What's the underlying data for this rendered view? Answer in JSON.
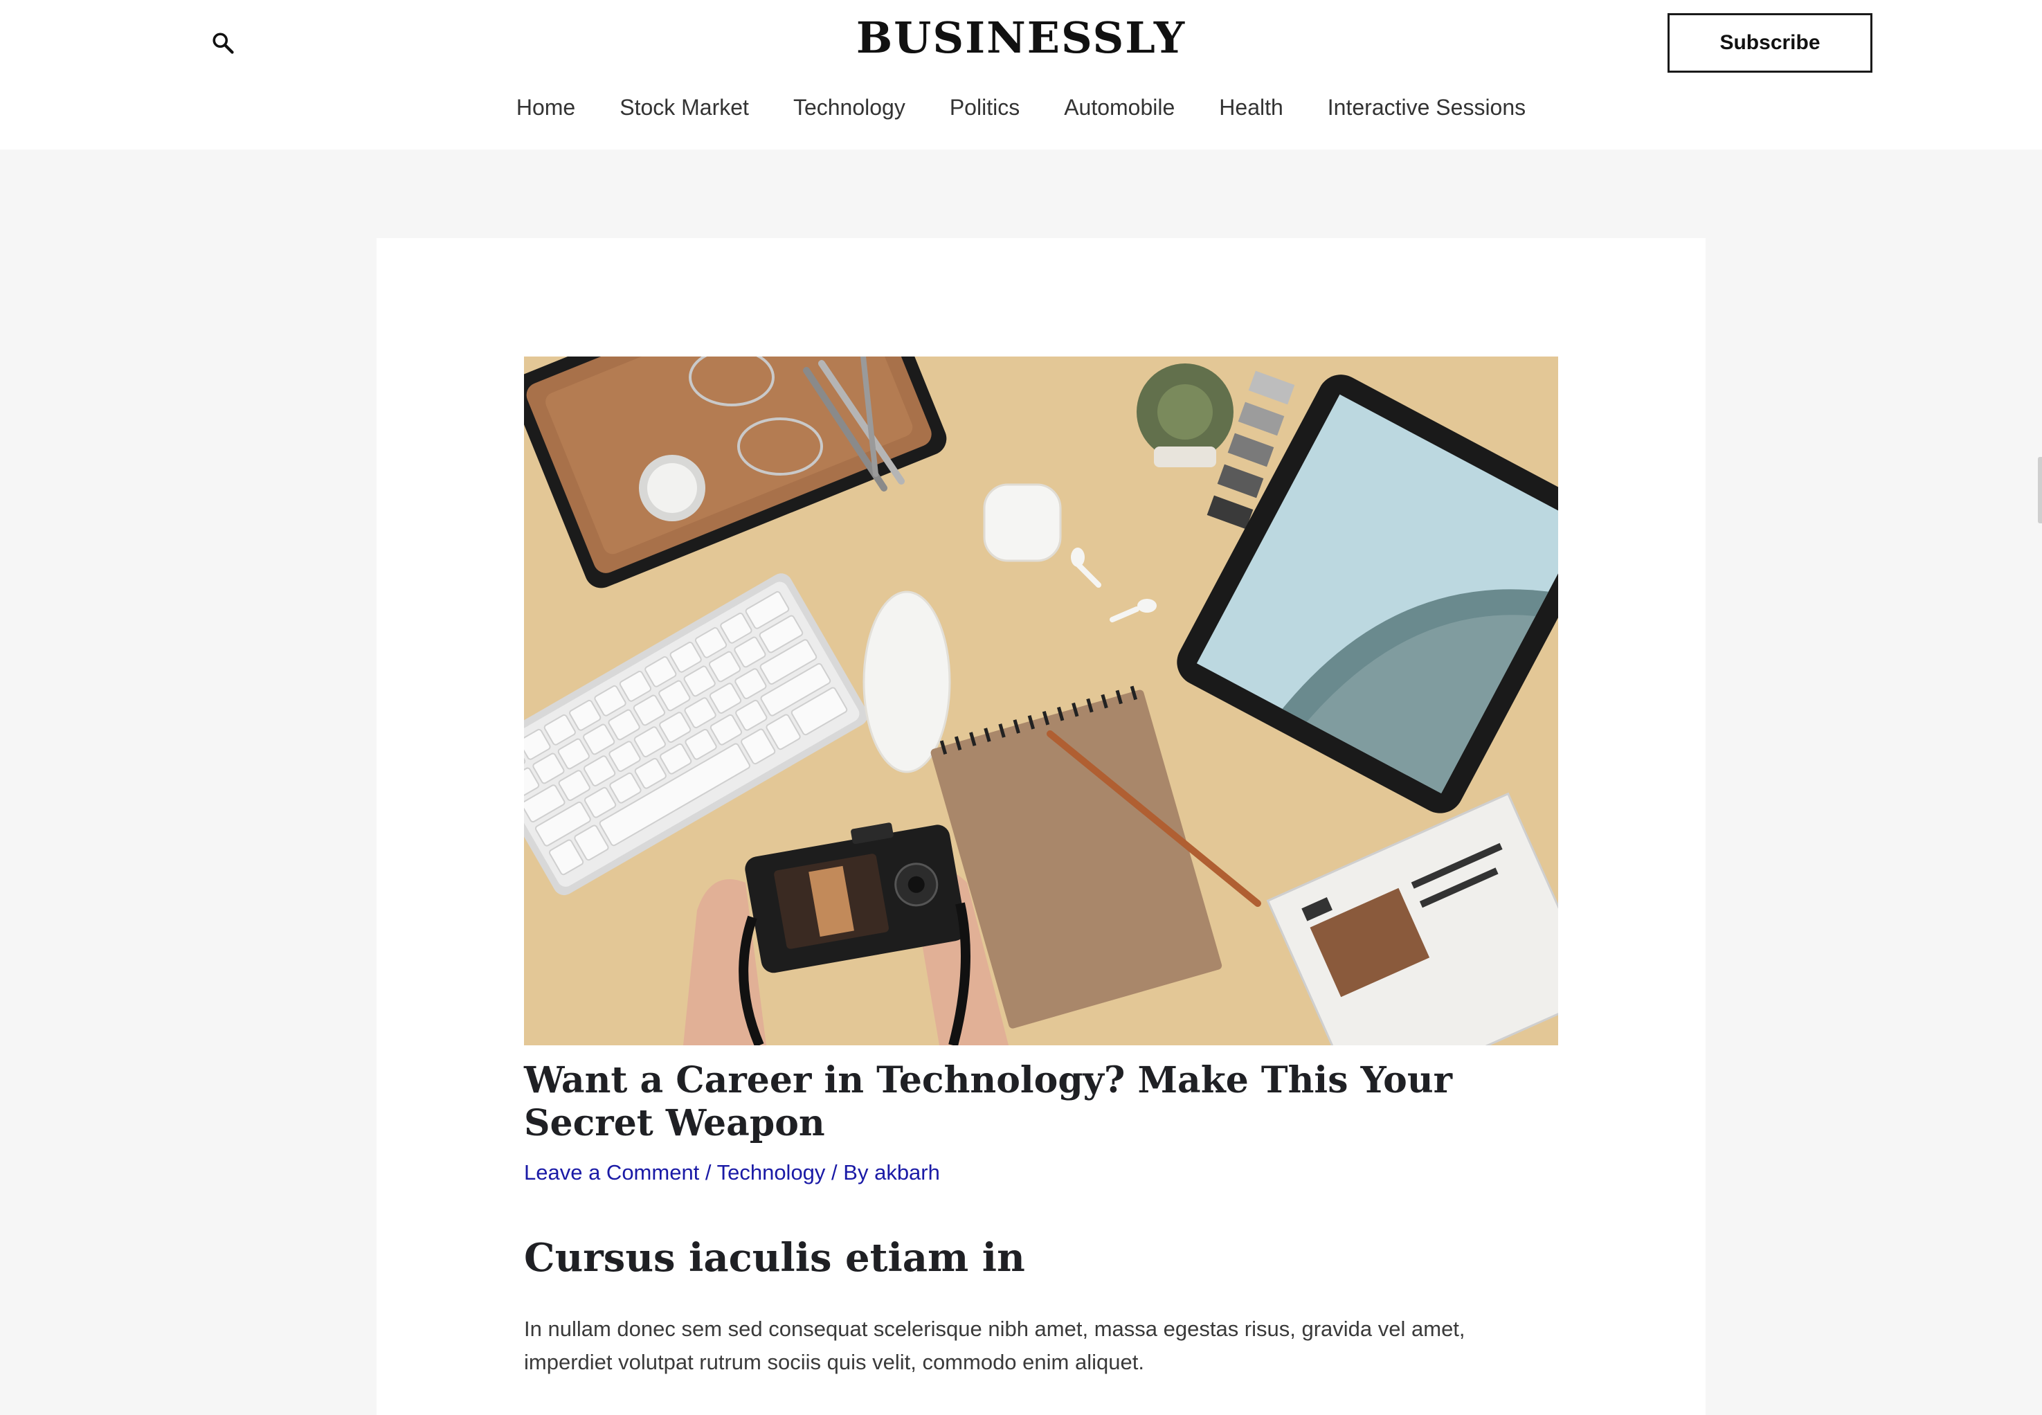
{
  "header": {
    "logo": "BUSINESSLY",
    "subscribe_label": "Subscribe",
    "search_icon": "search-icon",
    "nav": [
      {
        "label": "Home"
      },
      {
        "label": "Stock Market"
      },
      {
        "label": "Technology"
      },
      {
        "label": "Politics"
      },
      {
        "label": "Automobile"
      },
      {
        "label": "Health"
      },
      {
        "label": "Interactive Sessions"
      }
    ]
  },
  "article": {
    "title": "Want a Career in Technology? Make This Your Secret Weapon",
    "meta": {
      "comment_link": "Leave a Comment",
      "sep1": " / ",
      "category": "Technology",
      "sep2": " / By ",
      "author": "akbarh"
    },
    "section_heading": "Cursus iaculis etiam in",
    "body": "In nullam donec sem sed consequat scelerisque nibh amet, massa egestas risus, gravida vel amet, imperdiet volutpat rutrum sociis quis velit, commodo enim aliquet."
  },
  "colors": {
    "link": "#1a1aa6",
    "page_bg": "#f6f6f6",
    "hero_bg": "#e2c592"
  }
}
